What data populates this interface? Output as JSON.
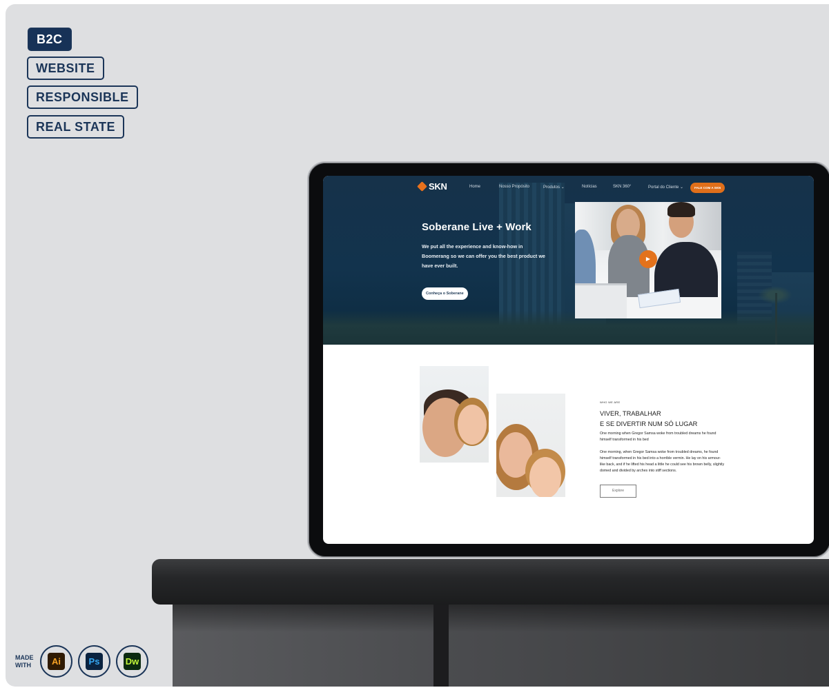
{
  "tags": [
    "B2C",
    "WEBSITE",
    "RESPONSIBLE",
    "REAL STATE"
  ],
  "site": {
    "logo_text": "SKN",
    "nav": [
      "Home",
      "Nosso Propósito",
      "Produtos",
      "Notícias",
      "SKN 360°",
      "Portal do Cliente"
    ],
    "nav_cta": "FALE COM A SKN",
    "hero": {
      "title": "Soberane Live + Work",
      "description": "We put all the experience and know-how in Boomerang so we can offer you the best product we have ever built.",
      "button": "Conheça o Soberane"
    },
    "about": {
      "eyebrow": "WHO WE ARE",
      "heading_line1": "VIVER, TRABALHAR",
      "heading_line2": "E SE DIVERTIR NUM SÓ LUGAR",
      "paragraph1": "One morning when Gregor Samsa woke from troubled dreams he found himself transformed in his bed",
      "paragraph2": "One morning, when Gregor Samsa woke from troubled dreams, he found himself transformed in his bed into a horrible vermin. He lay on his armour-like back, and if he lifted his head a little he could see his brown belly, slightly domed and divided by arches into stiff sections.",
      "explore_button": "Explore"
    }
  },
  "made_with": {
    "label_line1": "MADE",
    "label_line2": "WITH",
    "apps": [
      {
        "label": "Ai",
        "icon": "illustrator-icon",
        "bg": "#2f1a03",
        "fg": "#f6a224"
      },
      {
        "label": "Ps",
        "icon": "photoshop-icon",
        "bg": "#0b2340",
        "fg": "#37a8f2"
      },
      {
        "label": "Dw",
        "icon": "dreamweaver-icon",
        "bg": "#0b2a10",
        "fg": "#c3f73a"
      }
    ]
  },
  "colors": {
    "navy": "#1b3558",
    "orange_accent": "#e06f1a",
    "hero_bg": "#12334d"
  }
}
